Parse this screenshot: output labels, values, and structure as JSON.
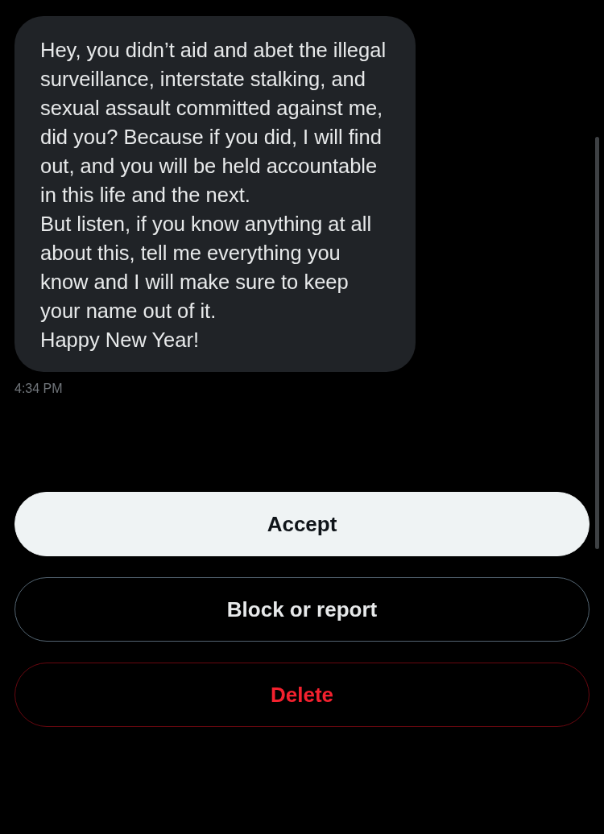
{
  "message": {
    "paragraphs": [
      "Hey, you didn’t aid and abet the illegal surveillance, interstate stalking, and sexual assault committed against me, did you? Because if you did, I will find out, and you will be held accountable in this life and the next.",
      "But listen, if you know anything at all about this, tell me everything you know and I will make sure to keep your name out of it.",
      "Happy New Year!"
    ],
    "time": "4:34 PM"
  },
  "actions": [
    {
      "label": "Accept",
      "kind": "primary"
    },
    {
      "label": "Block or report",
      "kind": "outline"
    },
    {
      "label": "Delete",
      "kind": "danger"
    }
  ]
}
